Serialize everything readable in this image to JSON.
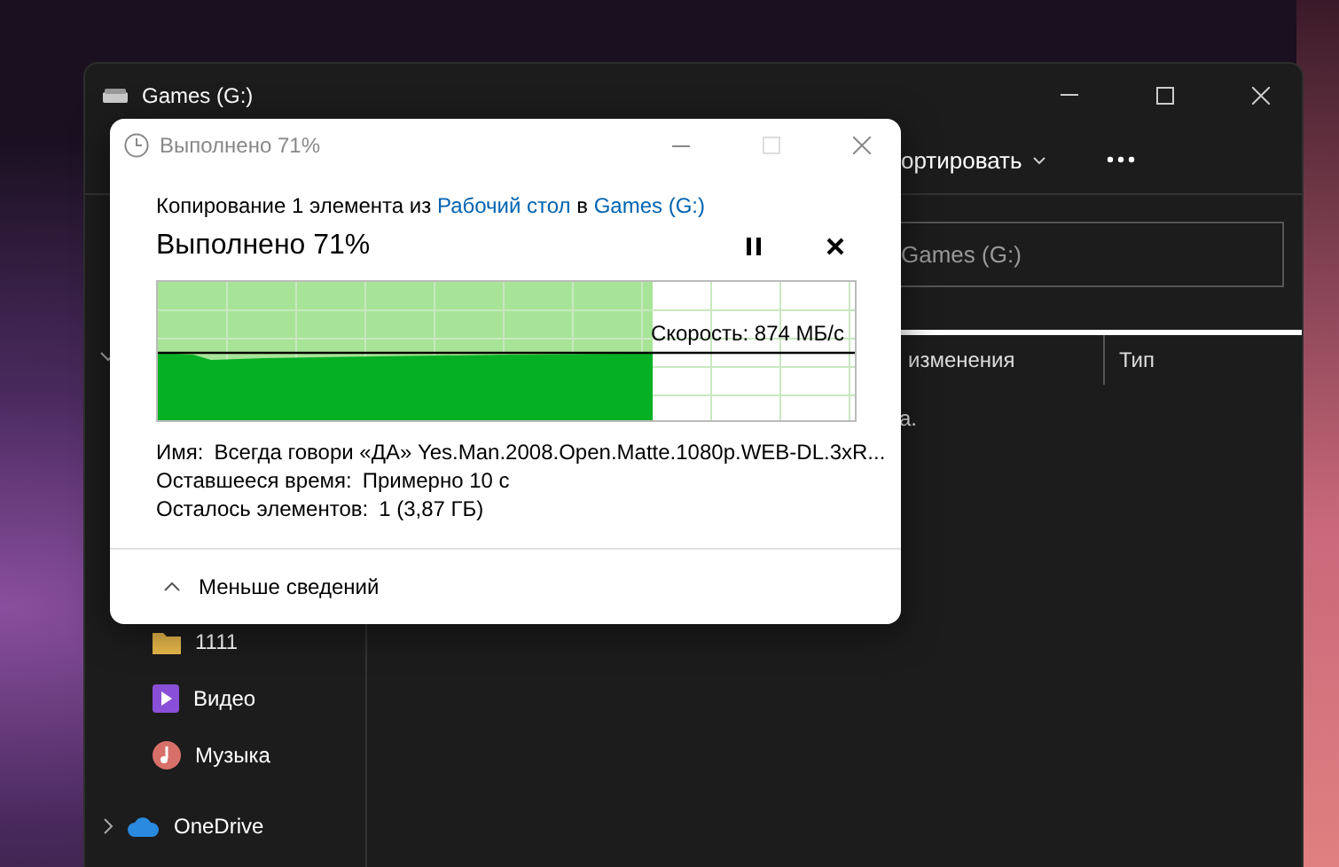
{
  "explorer": {
    "title": "Games (G:)",
    "sort_label": "ортировать",
    "search": {
      "placeholder": "Games (G:)"
    },
    "columns": [
      "изменения",
      "Тип"
    ],
    "content_text": "а.",
    "sidebar": {
      "items": [
        {
          "label": "1111",
          "kind": "folder"
        },
        {
          "label": "Видео",
          "kind": "video"
        },
        {
          "label": "Музыка",
          "kind": "music"
        },
        {
          "label": "OneDrive",
          "kind": "cloud"
        }
      ]
    }
  },
  "dialog": {
    "title": "Выполнено 71%",
    "description": [
      {
        "text": "Копирование 1 элемента из ",
        "kind": "plain"
      },
      {
        "text": "Рабочий стол",
        "kind": "link"
      },
      {
        "text": " в ",
        "kind": "plain"
      },
      {
        "text": "Games (G:)",
        "kind": "link"
      }
    ],
    "heading": "Выполнено 71%",
    "level": 0.71,
    "speed": "Скорость: 874 МБ/с",
    "details": [
      {
        "label": "Имя:",
        "value": "Всегда говори «ДА» Yes.Man.2008.Open.Matte.1080p.WEB-DL.3xR..."
      },
      {
        "label": "Оставшееся время:",
        "value": "Примерно 10 с"
      },
      {
        "label": "Осталось элементов:",
        "value": "1 (3,87 ГБ)"
      }
    ],
    "toggle_label": "Меньше сведений"
  }
}
